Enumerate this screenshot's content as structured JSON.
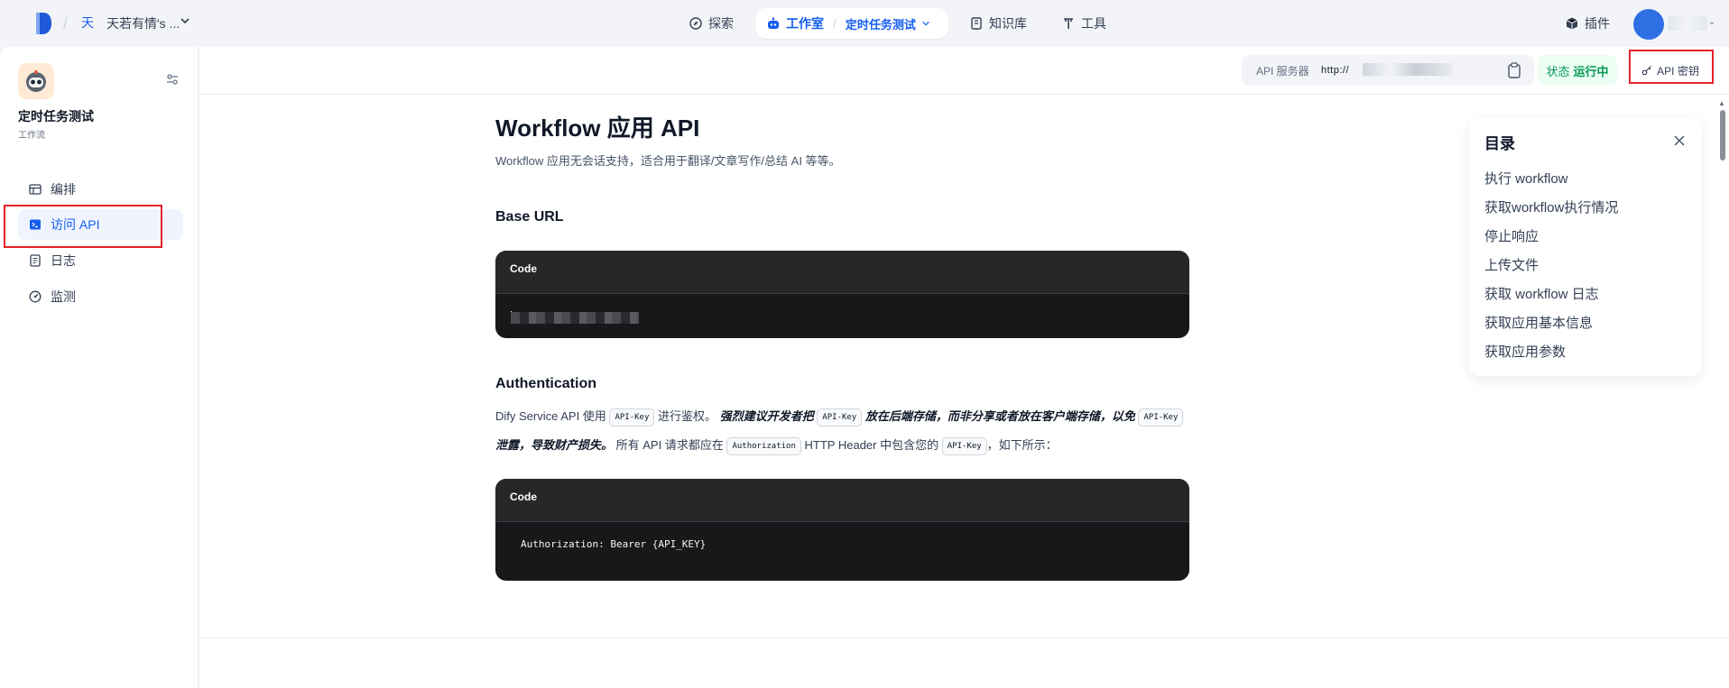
{
  "header": {
    "workspace_avatar": "天",
    "workspace_name": "天若有情's ...",
    "nav": {
      "explore": "探索",
      "studio": "工作室",
      "current_app": "定时任务测试",
      "knowledge": "知识库",
      "tools": "工具"
    },
    "plugins": "插件"
  },
  "sidebar": {
    "app_name": "定时任务测试",
    "app_type": "工作流",
    "items": [
      {
        "label": "编排",
        "icon": "layout-icon"
      },
      {
        "label": "访问 API",
        "icon": "terminal-icon"
      },
      {
        "label": "日志",
        "icon": "log-icon"
      },
      {
        "label": "监测",
        "icon": "gauge-icon"
      }
    ]
  },
  "toolbar": {
    "api_server_label": "API 服务器",
    "api_server_url": "http://",
    "status_label": "状态",
    "status_value": "运行中",
    "api_key_button": "API 密钥"
  },
  "doc": {
    "title": "Workflow 应用 API",
    "description": "Workflow 应用无会话支持，适合用于翻译/文章写作/总结 AI 等等。",
    "base_url_heading": "Base URL",
    "code_label": "Code",
    "base_url_value": "h",
    "auth_heading": "Authentication",
    "auth": {
      "t1": "Dify Service API 使用",
      "k_api_key": "API-Key",
      "t2": "进行鉴权。",
      "e1": "强烈建议开发者把",
      "e2": "放在后端存储，而非分享或者放在客户端存储，以免",
      "e3": "泄露，导致财产损失。",
      "t3": "所有 API 请求都应在",
      "k_authorization": "Authorization",
      "t4": "HTTP Header 中包含您的",
      "t5": "，如下所示："
    },
    "auth_code": "Authorization: Bearer {API_KEY}"
  },
  "toc": {
    "title": "目录",
    "items": [
      "执行 workflow",
      "获取workflow执行情况",
      "停止响应",
      "上传文件",
      "获取 workflow 日志",
      "获取应用基本信息",
      "获取应用参数"
    ]
  },
  "colors": {
    "accent": "#155eef",
    "status_green": "#039855",
    "highlight_red": "#e5222b",
    "code_bg": "#18181b"
  }
}
